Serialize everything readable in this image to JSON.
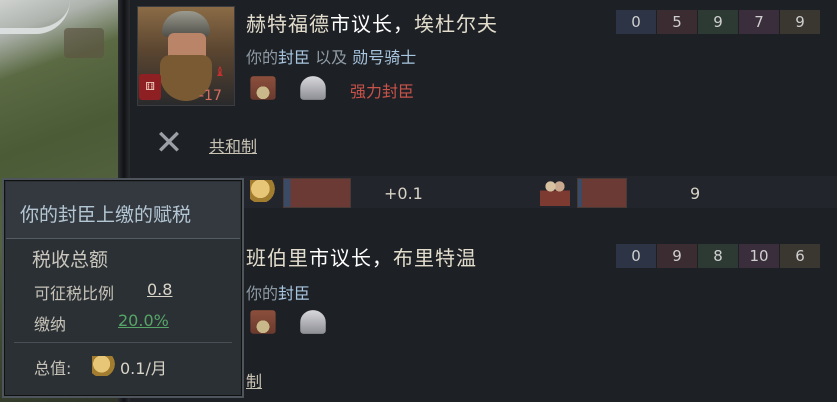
{
  "vassal1": {
    "name_prefix": "赫特福德",
    "name_title": "市议长，",
    "name_person": "埃杜尔夫",
    "relation_a": "你的",
    "relation_b": "封臣",
    "relation_c": " 以及 ",
    "relation_d": "勋号骑士",
    "opinion": "-17",
    "strong_label": "强力封臣",
    "stats": [
      "0",
      "5",
      "9",
      "7",
      "9"
    ],
    "law": "共和制"
  },
  "bar": {
    "tax_value": "+0.1",
    "levy_value": "9"
  },
  "vassal2": {
    "name_prefix": "班伯里",
    "name_title": "市议长，",
    "name_person": "布里特温",
    "relation_a": "你的",
    "relation_b": "封臣",
    "stats": [
      "0",
      "9",
      "8",
      "10",
      "6"
    ],
    "law": "制"
  },
  "tooltip": {
    "title": "你的封臣上缴的赋税",
    "section": "税收总额",
    "rate_label": "可征税比例",
    "rate_value": "0.8",
    "pay_label": "缴纳",
    "pay_value": "20.0%",
    "total_label": "总值:",
    "total_value": "0.1/月"
  },
  "icons": {
    "close": "close-x-icon",
    "coins": "gold-coins-icon",
    "soldiers": "levy-soldiers-icon",
    "house": "dynasty-house-icon",
    "crown": "coat-of-arms-icon",
    "dice": "dice-trait-icon"
  },
  "colors": {
    "opinion": "#d66d61",
    "strong": "#c8534a",
    "pay": "#56a567",
    "highlight": "#a8c6e0"
  }
}
